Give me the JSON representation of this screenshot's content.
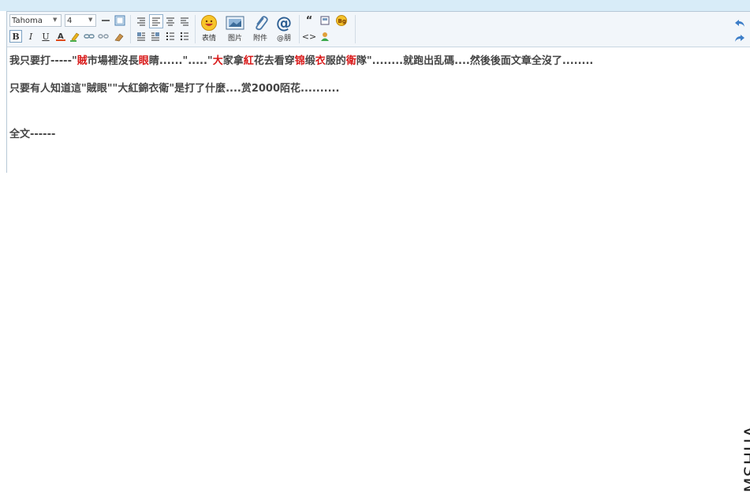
{
  "toolbar": {
    "font_family": "Tahoma",
    "font_size": "4",
    "buttons": {
      "bold": "B",
      "italic": "I",
      "underline": "U"
    },
    "big_buttons": [
      {
        "label": "表情",
        "icon": "smiley-icon"
      },
      {
        "label": "图片",
        "icon": "image-icon"
      },
      {
        "label": "附件",
        "icon": "paperclip-icon"
      },
      {
        "label": "@朋",
        "icon": "at-icon"
      }
    ],
    "quote_symbol": "“",
    "bg_badge": "Bg",
    "code_symbol": "<>"
  },
  "content": {
    "line1": [
      {
        "text": "我只要打-----\"",
        "red": false
      },
      {
        "text": "賊",
        "red": true
      },
      {
        "text": "市場裡沒長",
        "red": false
      },
      {
        "text": "眼",
        "red": true
      },
      {
        "text": "睛......\".....\"",
        "red": false
      },
      {
        "text": "大",
        "red": true
      },
      {
        "text": "家拿",
        "red": false
      },
      {
        "text": "紅",
        "red": true
      },
      {
        "text": "花去看穿",
        "red": false
      },
      {
        "text": "锦",
        "red": true
      },
      {
        "text": "缎",
        "red": false
      },
      {
        "text": "衣",
        "red": true
      },
      {
        "text": "服的",
        "red": false
      },
      {
        "text": "衛",
        "red": true
      },
      {
        "text": "隊\"........就跑出乱碼....然後後面文章全沒了........",
        "red": false
      }
    ],
    "line2": "只要有人知道這\"賊眼\"\"大紅錦衣衛\"是打了什麼....赏2000陌花..........",
    "line3": "全文------"
  },
  "watermark": "MSHUA",
  "colors": {
    "accent_red": "#d81818",
    "toolbar_bg": "#f2f6fa",
    "top_strip": "#d8ecf8"
  }
}
